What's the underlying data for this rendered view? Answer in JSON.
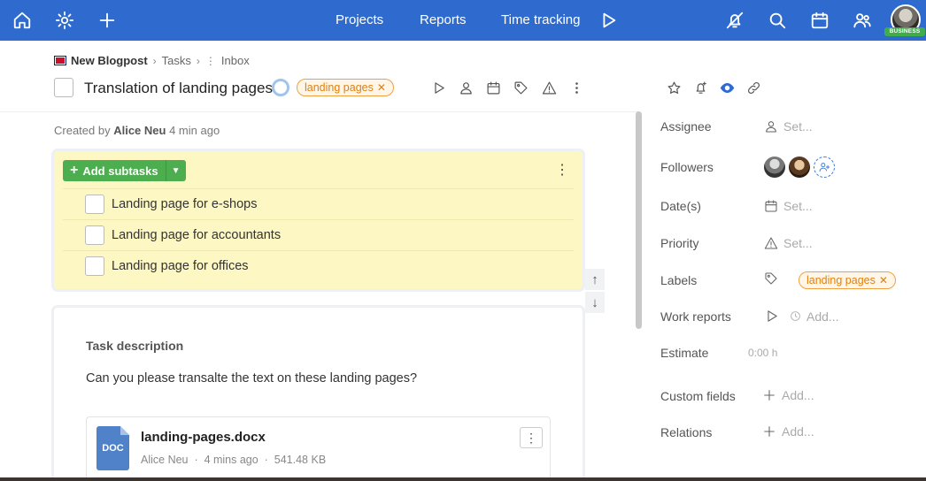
{
  "topbar": {
    "nav": [
      "Projects",
      "Reports",
      "Time tracking"
    ],
    "badge": "BUSINESS",
    "bg_color": "#2f6bcf"
  },
  "breadcrumb": {
    "project": "New Blogpost",
    "list": "Tasks",
    "section": "Inbox"
  },
  "task": {
    "title": "Translation of landing pages",
    "label": "landing pages",
    "created_prefix": "Created by",
    "created_by": "Alice Neu",
    "created_ago": "4 min ago"
  },
  "subtasks": {
    "add_label": "Add subtasks",
    "items": [
      "Landing page for e-shops",
      "Landing page for accountants",
      "Landing page for offices"
    ]
  },
  "description": {
    "label": "Task description",
    "text": "Can you please transalte the text on these landing pages?",
    "file": {
      "type_label": "DOC",
      "name": "landing-pages.docx",
      "author": "Alice Neu",
      "time": "4 mins ago",
      "size": "541.48 KB"
    }
  },
  "properties": {
    "assignee": {
      "label": "Assignee",
      "value": "Set..."
    },
    "followers": {
      "label": "Followers"
    },
    "dates": {
      "label": "Date(s)",
      "value": "Set..."
    },
    "priority": {
      "label": "Priority",
      "value": "Set..."
    },
    "labels": {
      "label": "Labels",
      "value": "landing pages"
    },
    "work_reports": {
      "label": "Work reports",
      "value": "Add..."
    },
    "estimate": {
      "label": "Estimate",
      "value": "0:00 h"
    },
    "custom_fields": {
      "label": "Custom fields",
      "value": "Add..."
    },
    "relations": {
      "label": "Relations",
      "value": "Add..."
    }
  },
  "colors": {
    "accent": "#2f6bcf",
    "green": "#4cae4f",
    "label_orange": "#e08010",
    "subtask_bg": "#fdf7c4"
  }
}
